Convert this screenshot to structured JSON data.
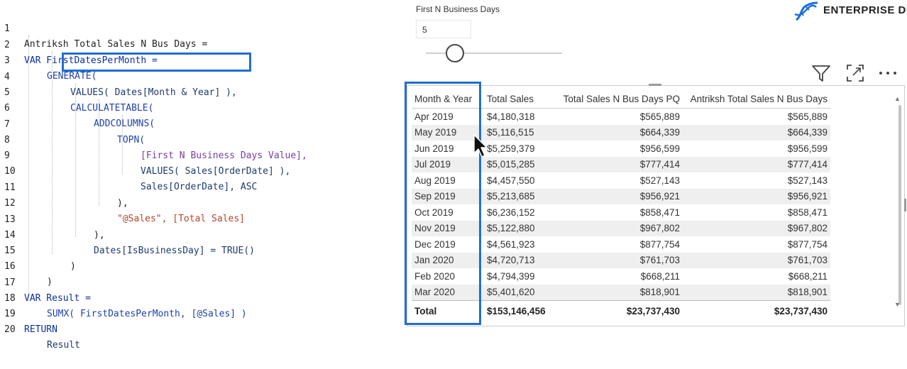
{
  "code": {
    "lines": [
      {
        "n": "1",
        "text": "Antriksh Total Sales N Bus Days ="
      },
      {
        "n": "2",
        "text": "VAR FirstDatesPerMonth ="
      },
      {
        "n": "3",
        "text": "GENERATE("
      },
      {
        "n": "4",
        "text": "VALUES( Dates[Month & Year] ),"
      },
      {
        "n": "5",
        "text": "CALCULATETABLE("
      },
      {
        "n": "6",
        "text": "ADDCOLUMNS("
      },
      {
        "n": "7",
        "text": "TOPN("
      },
      {
        "n": "8",
        "text": "[First N Business Days Value],"
      },
      {
        "n": "9",
        "text": "VALUES( Sales[OrderDate] ),"
      },
      {
        "n": "10",
        "text": "Sales[OrderDate], ASC"
      },
      {
        "n": "11",
        "text": "),"
      },
      {
        "n": "12",
        "text": "\"@Sales\", [Total Sales]"
      },
      {
        "n": "13",
        "text": "),"
      },
      {
        "n": "14",
        "text": "Dates[IsBusinessDay] = TRUE()"
      },
      {
        "n": "15",
        "text": ")"
      },
      {
        "n": "16",
        "text": ")"
      },
      {
        "n": "17",
        "text": "VAR Result ="
      },
      {
        "n": "18",
        "text": "SUMX( FirstDatesPerMonth, [@Sales] )"
      },
      {
        "n": "19",
        "text": "RETURN"
      },
      {
        "n": "20",
        "text": "Result"
      }
    ]
  },
  "slicer": {
    "title": "First N Business Days",
    "value": "5"
  },
  "logo": {
    "text": "ENTERPRISE DN",
    "color": "#1e6fd9"
  },
  "header_icons": [
    "filter-icon",
    "focus-mode-icon",
    "more-options-icon"
  ],
  "table": {
    "columns": [
      "Month & Year",
      "Total Sales",
      "Total Sales N Bus Days PQ",
      "Antriksh Total Sales N Bus Days"
    ],
    "rows": [
      [
        "Apr 2019",
        "$4,180,318",
        "$565,889",
        "$565,889"
      ],
      [
        "May 2019",
        "$5,116,515",
        "$664,339",
        "$664,339"
      ],
      [
        "Jun 2019",
        "$5,259,379",
        "$956,599",
        "$956,599"
      ],
      [
        "Jul 2019",
        "$5,015,285",
        "$777,414",
        "$777,414"
      ],
      [
        "Aug 2019",
        "$4,457,550",
        "$527,143",
        "$527,143"
      ],
      [
        "Sep 2019",
        "$5,213,685",
        "$956,921",
        "$956,921"
      ],
      [
        "Oct 2019",
        "$6,236,152",
        "$858,471",
        "$858,471"
      ],
      [
        "Nov 2019",
        "$5,122,880",
        "$967,802",
        "$967,802"
      ],
      [
        "Dec 2019",
        "$4,561,923",
        "$877,754",
        "$877,754"
      ],
      [
        "Jan 2020",
        "$4,720,713",
        "$761,703",
        "$761,703"
      ],
      [
        "Feb 2020",
        "$4,794,399",
        "$668,211",
        "$668,211"
      ],
      [
        "Mar 2020",
        "$5,401,620",
        "$818,901",
        "$818,901"
      ]
    ],
    "total": [
      "Total",
      "$153,146,456",
      "$23,737,430",
      "$23,737,430"
    ]
  },
  "colors": {
    "highlight": "#1f6fd1",
    "keyword": "#0b2f9e",
    "string": "#b5452b",
    "measure": "#7a3da6"
  }
}
